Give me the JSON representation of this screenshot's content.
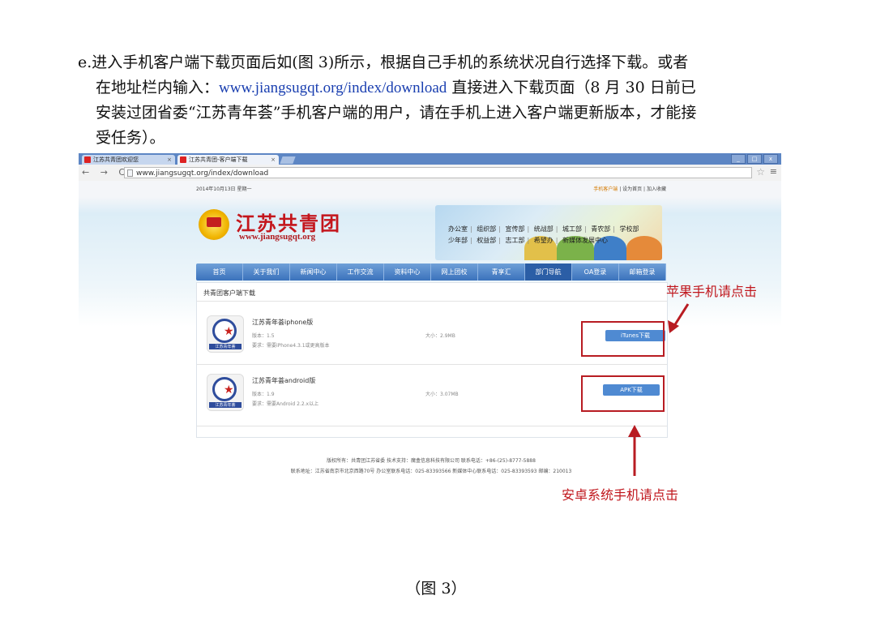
{
  "paragraph": {
    "line1": "e.进入手机客户端下载页面后如(图 3)所示，根据自己手机的系统状况自行选择下载。或者",
    "line2_pre": "在地址栏内输入：",
    "line2_link": "www.jiangsugqt.org/index/download",
    "line2_post": " 直接进入下载页面（8 月 30 日前已",
    "line3": "安装过团省委“江苏青年荟”手机客户端的用户，请在手机上进入客户端更新版本，才能接",
    "line4": "受任务）。"
  },
  "browser": {
    "tab1": "江苏共青团欢迎您",
    "tab2": "江苏共青团-客户端下载",
    "tab_close": "×",
    "nav_buttons": "← → C",
    "url": "www.jiangsugqt.org/index/download",
    "win_controls": [
      "_",
      "□",
      "x"
    ]
  },
  "site": {
    "date": "2014年10月13日  星期一",
    "top_links": [
      "手机客户端",
      "设为首页",
      "加入收藏"
    ],
    "logo_title": "江苏共青团",
    "logo_url": "www.jiangsugqt.org",
    "dept_links_row1": [
      "办公室",
      "组织部",
      "宣传部",
      "统战部",
      "城工部",
      "青农部",
      "学校部"
    ],
    "dept_links_row2": [
      "少年部",
      "权益部",
      "志工部",
      "希望办",
      "新媒体发展中心"
    ],
    "nav": [
      "首页",
      "关于我们",
      "新闻中心",
      "工作交流",
      "资料中心",
      "网上团校",
      "青享汇",
      "部门导航",
      "OA登录",
      "邮箱登录"
    ],
    "active_nav_index": 7,
    "panel_title": "共青团客户端下载",
    "apps": [
      {
        "name": "江苏青年荟iphone版",
        "version": "版本：1.5",
        "requirement": "要求：需要iPhone4.3.1或更高版本",
        "size": "大小：2.9MB",
        "button": "iTunes下载",
        "icon_caption": "江苏青年荟"
      },
      {
        "name": "江苏青年荟android版",
        "version": "版本：1.9",
        "requirement": "要求：需要Android 2.2.x以上",
        "size": "大小：3.07MB",
        "button": "APK下载",
        "icon_caption": "江苏青年荟"
      }
    ],
    "footer_line1": "版权所有：共青团江苏省委  技术支持：魔盒信息科技有限公司  联系电话：+86-(25)-8777-5888",
    "footer_line2": "联系地址：江苏省南京市北京西路70号 办公室联系电话：025-83393566 新媒体中心联系电话：025-83393593 邮编：210013"
  },
  "annotations": {
    "apple": "苹果手机请点击",
    "android": "安卓系统手机请点击",
    "color": "#c0161c"
  },
  "caption": "（图 3）"
}
